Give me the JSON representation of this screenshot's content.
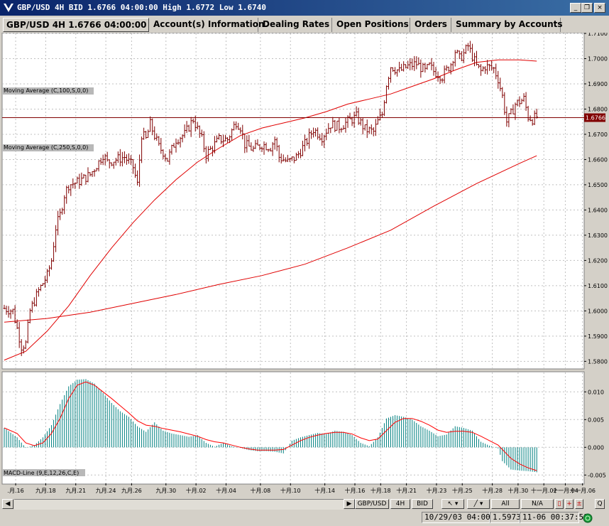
{
  "window": {
    "title": "GBP/USD 4H BID 1.6766 04:00:00 High 1.6772 Low 1.6740",
    "buttons": {
      "minimize": "_",
      "restore": "❐",
      "close": "×"
    }
  },
  "tabs": [
    {
      "label": "GBP/USD 4H 1.6766 04:00:00"
    },
    {
      "label": "Account(s) Information"
    },
    {
      "label": "Dealing Rates"
    },
    {
      "label": "Open Positions"
    },
    {
      "label": "Orders"
    },
    {
      "label": "Summary by Accounts"
    }
  ],
  "colors": {
    "candle": "#800000",
    "ma": "#e00000",
    "macd_hist": "#008080",
    "macd_signal": "#ff0000",
    "grid": "#c0c0c0",
    "price_line": "#800000"
  },
  "chart_data": {
    "type": "candlestick",
    "symbol": "GBP/USD",
    "timeframe": "4H",
    "current_price": "1.6766",
    "price_ylim": [
      1.577,
      1.71
    ],
    "price_ticks": [
      "1.7100",
      "1.7000",
      "1.6900",
      "1.6800",
      "1.6700",
      "1.6600",
      "1.6500",
      "1.6400",
      "1.6300",
      "1.6200",
      "1.6100",
      "1.6000",
      "1.5900",
      "1.5800"
    ],
    "ma_labels": [
      "Moving Average (C,100,S,0,0)",
      "Moving Average (C,250,S,0,0)"
    ],
    "close_path": [
      [
        0,
        1.601
      ],
      [
        2,
        1.6
      ],
      [
        4,
        1.586
      ],
      [
        5,
        1.587
      ],
      [
        6,
        1.6
      ],
      [
        8,
        1.608
      ],
      [
        10,
        1.614
      ],
      [
        11,
        1.62
      ],
      [
        12,
        1.633
      ],
      [
        13,
        1.638
      ],
      [
        14,
        1.646
      ],
      [
        15,
        1.65
      ],
      [
        17,
        1.651
      ],
      [
        18,
        1.652
      ],
      [
        20,
        1.654
      ],
      [
        22,
        1.659
      ],
      [
        23,
        1.662
      ],
      [
        24,
        1.659
      ],
      [
        26,
        1.66
      ],
      [
        28,
        1.661
      ],
      [
        30,
        1.657
      ],
      [
        31,
        1.65
      ],
      [
        32,
        1.67
      ],
      [
        33,
        1.668
      ],
      [
        34,
        1.674
      ],
      [
        36,
        1.665
      ],
      [
        37,
        1.663
      ],
      [
        38,
        1.66
      ],
      [
        40,
        1.668
      ],
      [
        42,
        1.67
      ],
      [
        44,
        1.676
      ],
      [
        46,
        1.668
      ],
      [
        47,
        1.662
      ],
      [
        48,
        1.664
      ],
      [
        50,
        1.668
      ],
      [
        52,
        1.668
      ],
      [
        54,
        1.675
      ],
      [
        55,
        1.673
      ],
      [
        56,
        1.666
      ],
      [
        58,
        1.664
      ],
      [
        60,
        1.666
      ],
      [
        62,
        1.665
      ],
      [
        63,
        1.668
      ],
      [
        64,
        1.661
      ],
      [
        66,
        1.659
      ],
      [
        68,
        1.661
      ],
      [
        70,
        1.666
      ],
      [
        72,
        1.672
      ],
      [
        74,
        1.669
      ],
      [
        76,
        1.674
      ],
      [
        78,
        1.673
      ],
      [
        80,
        1.675
      ],
      [
        82,
        1.677
      ],
      [
        84,
        1.672
      ],
      [
        86,
        1.671
      ],
      [
        87,
        1.675
      ],
      [
        88,
        1.678
      ],
      [
        89,
        1.69
      ],
      [
        90,
        1.697
      ],
      [
        92,
        1.695
      ],
      [
        94,
        1.697
      ],
      [
        96,
        1.698
      ],
      [
        98,
        1.695
      ],
      [
        99,
        1.697
      ],
      [
        100,
        1.695
      ],
      [
        102,
        1.693
      ],
      [
        104,
        1.698
      ],
      [
        105,
        1.703
      ],
      [
        106,
        1.7
      ],
      [
        107,
        1.702
      ],
      [
        108,
        1.705
      ],
      [
        110,
        1.697
      ],
      [
        111,
        1.695
      ],
      [
        112,
        1.697
      ],
      [
        114,
        1.696
      ],
      [
        115,
        1.692
      ],
      [
        116,
        1.685
      ],
      [
        117,
        1.675
      ],
      [
        118,
        1.678
      ],
      [
        119,
        1.682
      ],
      [
        120,
        1.683
      ],
      [
        121,
        1.684
      ],
      [
        122,
        1.677
      ],
      [
        123,
        1.676
      ],
      [
        124,
        1.677
      ]
    ],
    "ma100": [
      [
        0,
        1.5805
      ],
      [
        5,
        1.584
      ],
      [
        10,
        1.592
      ],
      [
        15,
        1.602
      ],
      [
        20,
        1.614
      ],
      [
        25,
        1.625
      ],
      [
        30,
        1.635
      ],
      [
        35,
        1.644
      ],
      [
        40,
        1.652
      ],
      [
        45,
        1.659
      ],
      [
        50,
        1.6645
      ],
      [
        55,
        1.6695
      ],
      [
        60,
        1.6725
      ],
      [
        65,
        1.6745
      ],
      [
        70,
        1.6765
      ],
      [
        75,
        1.679
      ],
      [
        80,
        1.682
      ],
      [
        85,
        1.684
      ],
      [
        90,
        1.686
      ],
      [
        95,
        1.689
      ],
      [
        100,
        1.692
      ],
      [
        105,
        1.6955
      ],
      [
        110,
        1.6985
      ],
      [
        115,
        1.6995
      ],
      [
        120,
        1.6995
      ],
      [
        124,
        1.699
      ]
    ],
    "ma250": [
      [
        0,
        1.5955
      ],
      [
        10,
        1.597
      ],
      [
        20,
        1.5995
      ],
      [
        30,
        1.603
      ],
      [
        40,
        1.6065
      ],
      [
        50,
        1.6105
      ],
      [
        60,
        1.614
      ],
      [
        70,
        1.6185
      ],
      [
        80,
        1.625
      ],
      [
        90,
        1.632
      ],
      [
        100,
        1.6415
      ],
      [
        110,
        1.6505
      ],
      [
        120,
        1.6585
      ],
      [
        124,
        1.6615
      ]
    ],
    "macd_ylim": [
      -0.0065,
      0.0135
    ],
    "macd_ticks": [
      "0.010",
      "0.005",
      "0.000",
      "-0.005"
    ],
    "macd_label": "MACD-Line (9,E,12,26,C,E)",
    "macd_hist": [
      [
        0,
        0.0035
      ],
      [
        3,
        0.0018
      ],
      [
        5,
        -0.0001
      ],
      [
        7,
        0.0004
      ],
      [
        9,
        0.0018
      ],
      [
        11,
        0.004
      ],
      [
        13,
        0.0078
      ],
      [
        15,
        0.011
      ],
      [
        17,
        0.0122
      ],
      [
        19,
        0.0123
      ],
      [
        21,
        0.0115
      ],
      [
        23,
        0.0098
      ],
      [
        25,
        0.008
      ],
      [
        27,
        0.0065
      ],
      [
        29,
        0.0055
      ],
      [
        31,
        0.0038
      ],
      [
        33,
        0.0028
      ],
      [
        35,
        0.0045
      ],
      [
        37,
        0.003
      ],
      [
        39,
        0.0025
      ],
      [
        41,
        0.0022
      ],
      [
        43,
        0.0019
      ],
      [
        45,
        0.0022
      ],
      [
        47,
        0.0008
      ],
      [
        49,
        0.0001
      ],
      [
        51,
        0.0008
      ],
      [
        53,
        0.0002
      ],
      [
        55,
        -0.0001
      ],
      [
        57,
        -0.0005
      ],
      [
        59,
        -0.0007
      ],
      [
        61,
        -0.0007
      ],
      [
        63,
        -0.0008
      ],
      [
        65,
        -0.0011
      ],
      [
        67,
        0.0012
      ],
      [
        69,
        0.0018
      ],
      [
        71,
        0.0022
      ],
      [
        73,
        0.0026
      ],
      [
        75,
        0.0024
      ],
      [
        77,
        0.003
      ],
      [
        79,
        0.0028
      ],
      [
        81,
        0.0022
      ],
      [
        83,
        0.0008
      ],
      [
        85,
        0.0002
      ],
      [
        87,
        0.0018
      ],
      [
        89,
        0.0052
      ],
      [
        91,
        0.0058
      ],
      [
        93,
        0.0055
      ],
      [
        95,
        0.005
      ],
      [
        97,
        0.0038
      ],
      [
        99,
        0.003
      ],
      [
        101,
        0.002
      ],
      [
        103,
        0.0023
      ],
      [
        105,
        0.0038
      ],
      [
        107,
        0.0035
      ],
      [
        109,
        0.003
      ],
      [
        111,
        0.001
      ],
      [
        113,
        0.0003
      ],
      [
        115,
        -0.0002
      ],
      [
        116,
        -0.0025
      ],
      [
        118,
        -0.004
      ],
      [
        120,
        -0.0042
      ],
      [
        122,
        -0.0043
      ],
      [
        124,
        -0.0045
      ]
    ],
    "macd_signal": [
      [
        0,
        0.0035
      ],
      [
        3,
        0.0025
      ],
      [
        5,
        0.0008
      ],
      [
        7,
        0.0003
      ],
      [
        9,
        0.0008
      ],
      [
        11,
        0.0025
      ],
      [
        13,
        0.0052
      ],
      [
        15,
        0.0088
      ],
      [
        17,
        0.0112
      ],
      [
        19,
        0.0118
      ],
      [
        21,
        0.0112
      ],
      [
        23,
        0.01
      ],
      [
        25,
        0.0088
      ],
      [
        27,
        0.0075
      ],
      [
        29,
        0.0062
      ],
      [
        31,
        0.0048
      ],
      [
        33,
        0.004
      ],
      [
        35,
        0.0038
      ],
      [
        37,
        0.0034
      ],
      [
        39,
        0.0031
      ],
      [
        41,
        0.0028
      ],
      [
        43,
        0.0024
      ],
      [
        45,
        0.002
      ],
      [
        47,
        0.0014
      ],
      [
        49,
        0.001
      ],
      [
        51,
        0.0008
      ],
      [
        53,
        0.0004
      ],
      [
        55,
        0
      ],
      [
        57,
        -0.0003
      ],
      [
        59,
        -0.0005
      ],
      [
        61,
        -0.0005
      ],
      [
        63,
        -0.0005
      ],
      [
        65,
        -0.0004
      ],
      [
        67,
        0.0004
      ],
      [
        69,
        0.0012
      ],
      [
        71,
        0.0018
      ],
      [
        73,
        0.0022
      ],
      [
        75,
        0.0025
      ],
      [
        77,
        0.0027
      ],
      [
        79,
        0.0027
      ],
      [
        81,
        0.0024
      ],
      [
        83,
        0.0017
      ],
      [
        85,
        0.0012
      ],
      [
        87,
        0.0015
      ],
      [
        89,
        0.003
      ],
      [
        91,
        0.0045
      ],
      [
        93,
        0.0052
      ],
      [
        95,
        0.0052
      ],
      [
        97,
        0.0047
      ],
      [
        99,
        0.004
      ],
      [
        101,
        0.0031
      ],
      [
        103,
        0.0027
      ],
      [
        105,
        0.0029
      ],
      [
        107,
        0.0029
      ],
      [
        109,
        0.0027
      ],
      [
        111,
        0.002
      ],
      [
        113,
        0.0012
      ],
      [
        115,
        0.0004
      ],
      [
        116,
        -0.0004
      ],
      [
        118,
        -0.002
      ],
      [
        120,
        -0.003
      ],
      [
        122,
        -0.0037
      ],
      [
        124,
        -0.0042
      ]
    ],
    "x_labels": [
      ".月.16",
      "九月.18",
      "九月.21",
      "九月.24",
      "九月.26",
      "九月.30",
      "十月.02",
      "十月.04",
      "十月.08",
      "十月.10",
      "十月.14",
      "十月.16",
      "十月.18",
      "十月.21",
      "十月.23",
      "十月.25",
      "十月.28",
      "十月.30",
      "十一月.02",
      "十一月.04",
      "十一月.06"
    ],
    "x_label_pos": [
      1,
      8,
      15,
      22,
      28,
      36,
      43,
      50,
      58,
      65,
      73,
      80,
      86,
      92,
      99,
      105,
      112,
      118,
      124,
      129,
      133
    ]
  },
  "statusbar": {
    "symbol_button": "GBP/USD",
    "timeframe_button": "4H",
    "price_type_button": "BID",
    "all_button": "All",
    "na_button": "N/A",
    "q_button": "Q",
    "datetime": "10/29/03 04:00",
    "cursor_price": "1.5973",
    "clock": "11-06  00:37:51"
  }
}
